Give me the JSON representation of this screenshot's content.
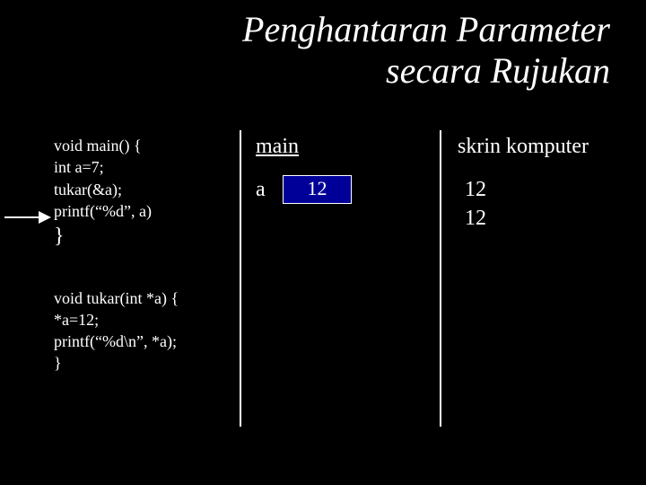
{
  "title_line1": "Penghantaran Parameter",
  "title_line2": "secara Rujukan",
  "code_fn1": {
    "l1": "void main() {",
    "l2": "int a=7;",
    "l3": "tukar(&a);",
    "l4": "printf(“%d”, a)",
    "l5": "}"
  },
  "code_fn2": {
    "l1": "void tukar(int *a) {",
    "l2": "*a=12;",
    "l3": "printf(“%d\\n”, *a);",
    "l4": "}"
  },
  "memory": {
    "header": "main",
    "var_label": "a",
    "var_value": "12"
  },
  "output": {
    "header": "skrin komputer",
    "line1": "12",
    "line2": "12"
  }
}
